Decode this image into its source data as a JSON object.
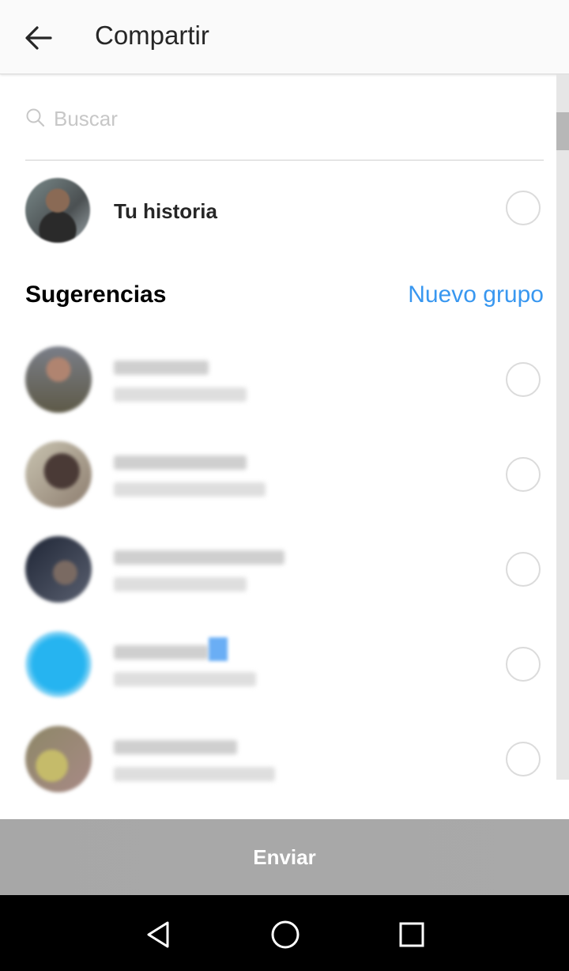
{
  "header": {
    "title": "Compartir"
  },
  "search": {
    "placeholder": "Buscar",
    "value": ""
  },
  "story": {
    "label": "Tu historia",
    "selected": false
  },
  "suggestions": {
    "title": "Sugerencias",
    "new_group_label": "Nuevo grupo"
  },
  "contacts": [
    {
      "selected": false,
      "avatar_colors": [
        "#7a7e88",
        "#b08470",
        "#5e5a48"
      ]
    },
    {
      "selected": false,
      "avatar_colors": [
        "#c9c4b1",
        "#4a3a36",
        "#8d7d6f"
      ]
    },
    {
      "selected": false,
      "avatar_colors": [
        "#1f2636",
        "#5a6070",
        "#7a6a62"
      ]
    },
    {
      "selected": false,
      "avatar_colors": [
        "#2aa7e8",
        "#26b4f0",
        "#9fdcf7"
      ]
    },
    {
      "selected": false,
      "avatar_colors": [
        "#8d8767",
        "#c5bb6a",
        "#a88a86"
      ]
    }
  ],
  "footer": {
    "send_label": "Enviar"
  },
  "colors": {
    "accent": "#3897f0",
    "send_bar": "#a8a8a8"
  },
  "navbar": {
    "icons": [
      "back-triangle-icon",
      "home-circle-icon",
      "recents-square-icon"
    ]
  }
}
